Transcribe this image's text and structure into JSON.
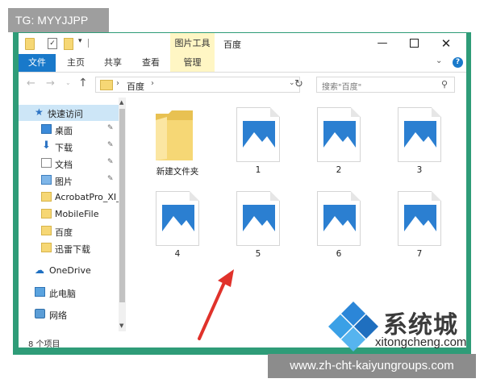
{
  "watermark_tag": "TG: MYYJJPP",
  "url_banner": "www.zh-cht-kaiyungroups.com",
  "brand": {
    "name": "系统城",
    "sub": "xitongcheng.com"
  },
  "window": {
    "title": "百度",
    "contextual_tab": "图片工具",
    "controls": {
      "minimize": "—",
      "close": "✕"
    }
  },
  "quick_access_toolbar": {
    "dropdown": "▾"
  },
  "ribbon": {
    "tabs": [
      "文件",
      "主页",
      "共享",
      "查看",
      "管理"
    ],
    "chevron": "⌄",
    "help": "?"
  },
  "address_bar": {
    "back": "←",
    "forward": "→",
    "recent": "⌄",
    "up": "↑",
    "path": [
      "百度"
    ],
    "separator": "›",
    "dropdown": "⌄",
    "refresh": "↻"
  },
  "search": {
    "placeholder": "搜索\"百度\"",
    "icon": "⚲"
  },
  "nav_pane": {
    "items": [
      {
        "label": "快速访问",
        "icon": "star-icon"
      },
      {
        "label": "桌面",
        "icon": "desktop-icon",
        "pinned": true
      },
      {
        "label": "下载",
        "icon": "download-icon",
        "pinned": true
      },
      {
        "label": "文档",
        "icon": "document-icon",
        "pinned": true
      },
      {
        "label": "图片",
        "icon": "pictures-icon",
        "pinned": true
      },
      {
        "label": "AcrobatPro_XI_",
        "icon": "folder-icon"
      },
      {
        "label": "MobileFile",
        "icon": "folder-icon"
      },
      {
        "label": "百度",
        "icon": "folder-icon"
      },
      {
        "label": "迅雷下载",
        "icon": "folder-icon"
      },
      {
        "label": "OneDrive",
        "icon": "onedrive-icon"
      },
      {
        "label": "此电脑",
        "icon": "this-pc-icon"
      },
      {
        "label": "网络",
        "icon": "network-icon"
      }
    ],
    "pin_glyph": "📌"
  },
  "content": {
    "items": [
      {
        "label": "新建文件夹",
        "type": "folder"
      },
      {
        "label": "1",
        "type": "image"
      },
      {
        "label": "2",
        "type": "image"
      },
      {
        "label": "3",
        "type": "image"
      },
      {
        "label": "4",
        "type": "image"
      },
      {
        "label": "5",
        "type": "image"
      },
      {
        "label": "6",
        "type": "image"
      },
      {
        "label": "7",
        "type": "image"
      }
    ]
  },
  "status_bar": {
    "item_count": "8 个项目"
  },
  "colors": {
    "accent": "#1979ca",
    "frame_green": "#2f9c78",
    "folder_yellow": "#f6d775",
    "image_blue": "#2b7fd1",
    "arrow_red": "#e0322b"
  }
}
